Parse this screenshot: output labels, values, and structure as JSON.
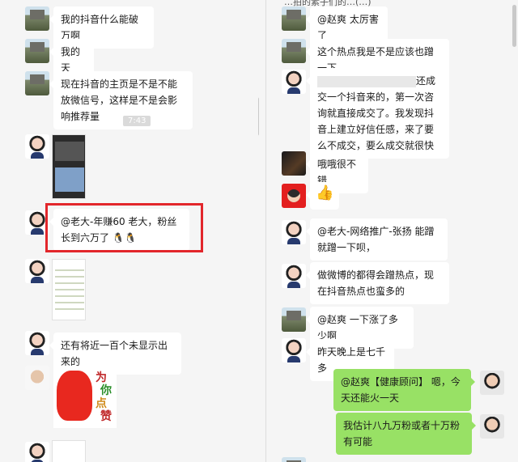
{
  "left_chat": {
    "messages": [
      {
        "text": "我的抖音什么能破万啊"
      },
      {
        "text": "我的天"
      },
      {
        "text": "现在抖音的主页是不是不能放微信号，这样是不是会影响推荐量"
      },
      {
        "text": "@老大-年赚60 老大，粉丝长到六万了"
      },
      {
        "text": "还有将近一百个未显示出来的"
      }
    ],
    "time_label": "7:43",
    "sticker": {
      "text_1": "为",
      "text_2": "你",
      "text_3": "点",
      "text_4": "赞"
    }
  },
  "right_chat": {
    "header_text": "…拍的素子们的…(…)",
    "messages": [
      {
        "text": "@赵爽 太厉害了"
      },
      {
        "text": "这个热点我是不是应该也蹭一下"
      },
      {
        "text_a": "还成交",
        "text_b": "一个抖音来的，第一次咨询就直接成交了。我发现抖音上建立好信任感，来了要么不成交，要么成交就很快"
      },
      {
        "text": "哦哦很不错"
      },
      {
        "text": "@老大-网络推广-张扬 能蹭就蹭一下呗，"
      },
      {
        "text": "做微博的都得会蹭热点，现在抖音热点也蛮多的"
      },
      {
        "text": "@赵爽 一下涨了多少啊"
      },
      {
        "text": "昨天晚上是七千多"
      },
      {
        "text": "@赵爽【健康顾问】 嗯，今天还能火一天"
      },
      {
        "text": "我估计八九万粉或者十万粉有可能"
      }
    ]
  },
  "colors": {
    "my_bubble": "#98e165",
    "highlight_box": "#e2262b",
    "background": "#f5f5f5"
  },
  "icons": [
    "castle-avatar",
    "woman-avatar",
    "man-avatar",
    "thumbs-up-emoji",
    "qq-penguin-emoji"
  ]
}
